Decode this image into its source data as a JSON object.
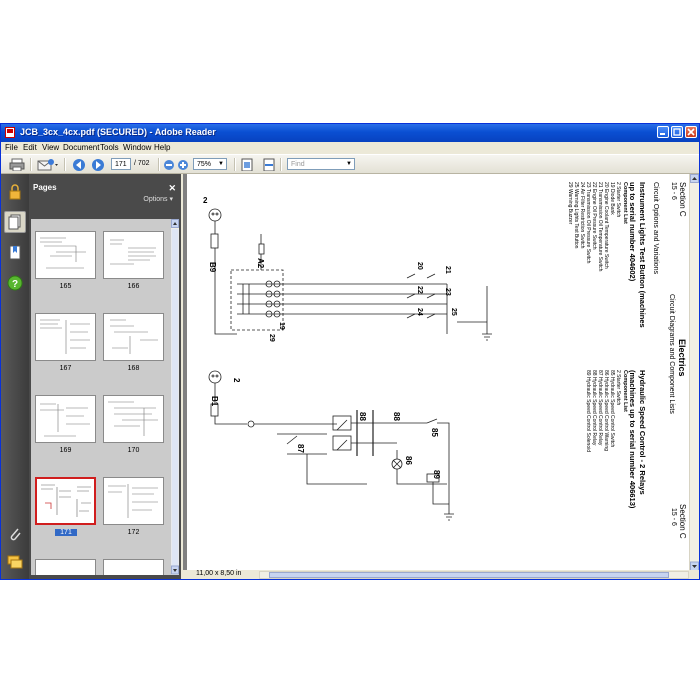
{
  "window": {
    "title": "JCB_3cx_4cx.pdf (SECURED) - Adobe Reader"
  },
  "menu": [
    "File",
    "Edit",
    "View",
    "Document",
    "Tools",
    "Window",
    "Help"
  ],
  "toolbar": {
    "page_current": "171",
    "page_total": "/ 702",
    "zoom": "75%",
    "find_placeholder": "Find"
  },
  "pages_panel": {
    "title": "Pages",
    "options_label": "Options",
    "thumbnails": [
      {
        "label": "165"
      },
      {
        "label": "166"
      },
      {
        "label": "167"
      },
      {
        "label": "168"
      },
      {
        "label": "169"
      },
      {
        "label": "170"
      },
      {
        "label": "171",
        "selected": true
      },
      {
        "label": "172"
      }
    ]
  },
  "status": {
    "page_size": "11,00 x 8,50 in"
  },
  "document": {
    "section": "Section C",
    "page_ref": "15 - 6",
    "heading": "Electrics",
    "subheading": "Circuit Diagrams and Component Lists",
    "circuit_options": "Circuit Options and Variations",
    "left_title_1": "Instrument Lights Test Button (machines",
    "left_title_2": "up to serial number 404602)",
    "left_list_title": "Component List",
    "left_components": [
      "2   Starter Switch",
      "19  Diode Bank",
      "20  Engine Coolant Temperature Switch",
      "21  Transmission Oil Temperature Switch",
      "22  Engine Oil Pressure Switch",
      "23  Transmission Oil Pressure Switch",
      "24  Air Filter Restriction Switch",
      "25  Warning Lights Test Button",
      "29  Warning Buzzer"
    ],
    "right_title_1": "Hydraulic Speed Control - 2 Relays",
    "right_title_2": "(machines up to serial number 406613)",
    "right_list_title": "Component List",
    "right_components": [
      "2   Starter Switch",
      "85  Hydraulic Speed Control Switch",
      "86  Hydraulic Speed Control Warning",
      "87  Hydraulic Speed Control Relay",
      "88  Hydraulic Speed Control Relay",
      "89  Hydraulic Speed Control Solenoid"
    ],
    "diagram_labels": {
      "a2": "A2",
      "b9": "B9",
      "b1": "B1",
      "c2_top": "2",
      "c2_bottom": "2",
      "c19": "19",
      "c29": "29",
      "c20": "20",
      "c21": "21",
      "c22": "22",
      "c23": "23",
      "c24": "24",
      "c25": "25",
      "c85": "85",
      "c86": "86",
      "c87": "87",
      "c88a": "88",
      "c88b": "88",
      "c89": "89"
    }
  }
}
